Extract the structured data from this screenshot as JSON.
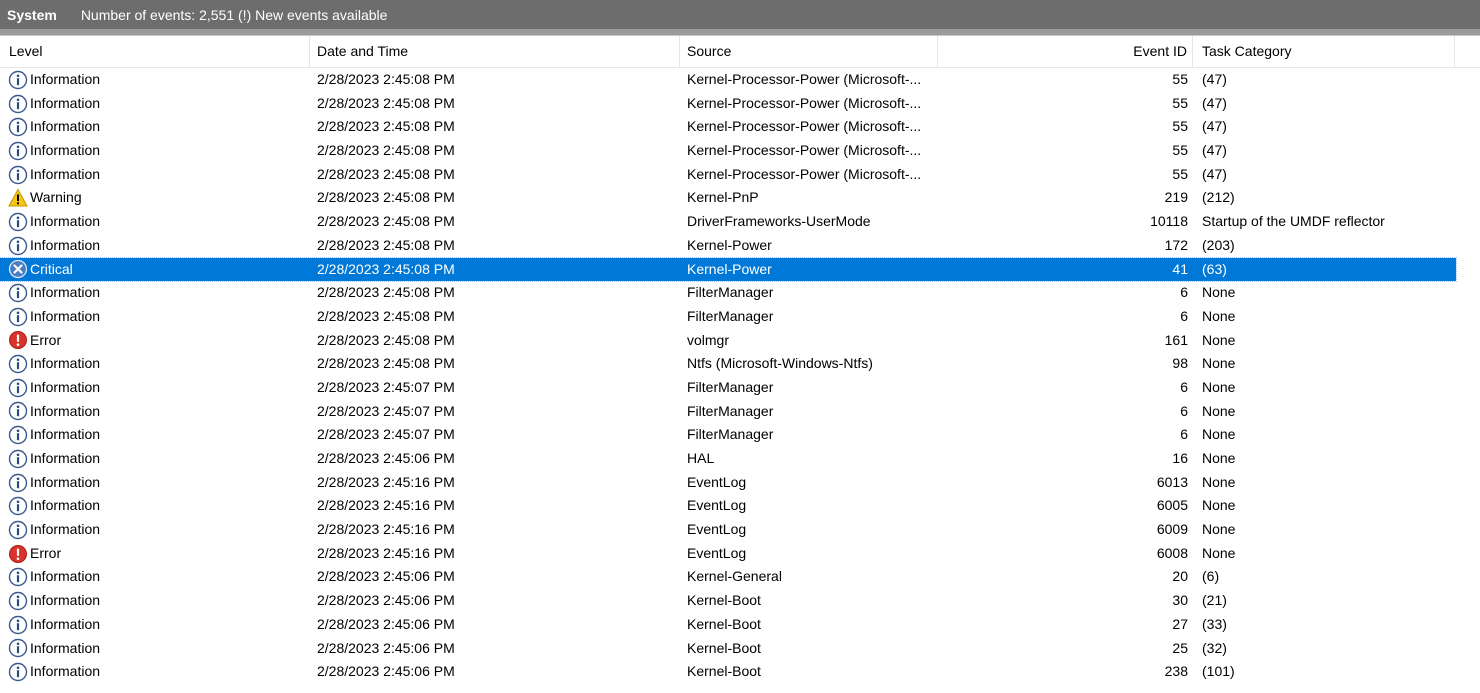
{
  "header": {
    "log_name": "System",
    "info": "Number of events: 2,551 (!) New events available"
  },
  "columns": {
    "level": "Level",
    "date": "Date and Time",
    "source": "Source",
    "event_id": "Event ID",
    "task": "Task Category"
  },
  "selected_index": 8,
  "rows": [
    {
      "level": "Information",
      "icon": "information-icon",
      "date": "2/28/2023 2:45:08 PM",
      "source": "Kernel-Processor-Power (Microsoft-...",
      "id": "55",
      "task": "(47)"
    },
    {
      "level": "Information",
      "icon": "information-icon",
      "date": "2/28/2023 2:45:08 PM",
      "source": "Kernel-Processor-Power (Microsoft-...",
      "id": "55",
      "task": "(47)"
    },
    {
      "level": "Information",
      "icon": "information-icon",
      "date": "2/28/2023 2:45:08 PM",
      "source": "Kernel-Processor-Power (Microsoft-...",
      "id": "55",
      "task": "(47)"
    },
    {
      "level": "Information",
      "icon": "information-icon",
      "date": "2/28/2023 2:45:08 PM",
      "source": "Kernel-Processor-Power (Microsoft-...",
      "id": "55",
      "task": "(47)"
    },
    {
      "level": "Information",
      "icon": "information-icon",
      "date": "2/28/2023 2:45:08 PM",
      "source": "Kernel-Processor-Power (Microsoft-...",
      "id": "55",
      "task": "(47)"
    },
    {
      "level": "Warning",
      "icon": "warning-icon",
      "date": "2/28/2023 2:45:08 PM",
      "source": "Kernel-PnP",
      "id": "219",
      "task": "(212)"
    },
    {
      "level": "Information",
      "icon": "information-icon",
      "date": "2/28/2023 2:45:08 PM",
      "source": "DriverFrameworks-UserMode",
      "id": "10118",
      "task": "Startup of the UMDF reflector"
    },
    {
      "level": "Information",
      "icon": "information-icon",
      "date": "2/28/2023 2:45:08 PM",
      "source": "Kernel-Power",
      "id": "172",
      "task": "(203)"
    },
    {
      "level": "Critical",
      "icon": "critical-icon",
      "date": "2/28/2023 2:45:08 PM",
      "source": "Kernel-Power",
      "id": "41",
      "task": "(63)"
    },
    {
      "level": "Information",
      "icon": "information-icon",
      "date": "2/28/2023 2:45:08 PM",
      "source": "FilterManager",
      "id": "6",
      "task": "None"
    },
    {
      "level": "Information",
      "icon": "information-icon",
      "date": "2/28/2023 2:45:08 PM",
      "source": "FilterManager",
      "id": "6",
      "task": "None"
    },
    {
      "level": "Error",
      "icon": "error-icon",
      "date": "2/28/2023 2:45:08 PM",
      "source": "volmgr",
      "id": "161",
      "task": "None"
    },
    {
      "level": "Information",
      "icon": "information-icon",
      "date": "2/28/2023 2:45:08 PM",
      "source": "Ntfs (Microsoft-Windows-Ntfs)",
      "id": "98",
      "task": "None"
    },
    {
      "level": "Information",
      "icon": "information-icon",
      "date": "2/28/2023 2:45:07 PM",
      "source": "FilterManager",
      "id": "6",
      "task": "None"
    },
    {
      "level": "Information",
      "icon": "information-icon",
      "date": "2/28/2023 2:45:07 PM",
      "source": "FilterManager",
      "id": "6",
      "task": "None"
    },
    {
      "level": "Information",
      "icon": "information-icon",
      "date": "2/28/2023 2:45:07 PM",
      "source": "FilterManager",
      "id": "6",
      "task": "None"
    },
    {
      "level": "Information",
      "icon": "information-icon",
      "date": "2/28/2023 2:45:06 PM",
      "source": "HAL",
      "id": "16",
      "task": "None"
    },
    {
      "level": "Information",
      "icon": "information-icon",
      "date": "2/28/2023 2:45:16 PM",
      "source": "EventLog",
      "id": "6013",
      "task": "None"
    },
    {
      "level": "Information",
      "icon": "information-icon",
      "date": "2/28/2023 2:45:16 PM",
      "source": "EventLog",
      "id": "6005",
      "task": "None"
    },
    {
      "level": "Information",
      "icon": "information-icon",
      "date": "2/28/2023 2:45:16 PM",
      "source": "EventLog",
      "id": "6009",
      "task": "None"
    },
    {
      "level": "Error",
      "icon": "error-icon",
      "date": "2/28/2023 2:45:16 PM",
      "source": "EventLog",
      "id": "6008",
      "task": "None"
    },
    {
      "level": "Information",
      "icon": "information-icon",
      "date": "2/28/2023 2:45:06 PM",
      "source": "Kernel-General",
      "id": "20",
      "task": "(6)"
    },
    {
      "level": "Information",
      "icon": "information-icon",
      "date": "2/28/2023 2:45:06 PM",
      "source": "Kernel-Boot",
      "id": "30",
      "task": "(21)"
    },
    {
      "level": "Information",
      "icon": "information-icon",
      "date": "2/28/2023 2:45:06 PM",
      "source": "Kernel-Boot",
      "id": "27",
      "task": "(33)"
    },
    {
      "level": "Information",
      "icon": "information-icon",
      "date": "2/28/2023 2:45:06 PM",
      "source": "Kernel-Boot",
      "id": "25",
      "task": "(32)"
    },
    {
      "level": "Information",
      "icon": "information-icon",
      "date": "2/28/2023 2:45:06 PM",
      "source": "Kernel-Boot",
      "id": "238",
      "task": "(101)"
    }
  ]
}
